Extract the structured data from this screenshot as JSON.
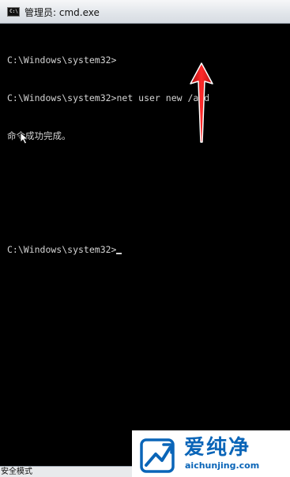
{
  "window": {
    "title": "管理员: cmd.exe",
    "icon": "cmd-app-icon",
    "icon_text": "C:\\"
  },
  "console": {
    "lines": [
      "C:\\Windows\\system32>",
      "C:\\Windows\\system32>net user new /add",
      "命令成功完成。",
      "",
      "",
      "C:\\Windows\\system32>"
    ]
  },
  "statusbar": {
    "text": "安全模式"
  },
  "watermark": {
    "brand": "爱纯净",
    "url": "aichunjing.com"
  },
  "colors": {
    "console_bg": "#000000",
    "console_text": "#d3d3d3",
    "annotation_arrow": "#e01818",
    "brand": "#0a65b8"
  }
}
